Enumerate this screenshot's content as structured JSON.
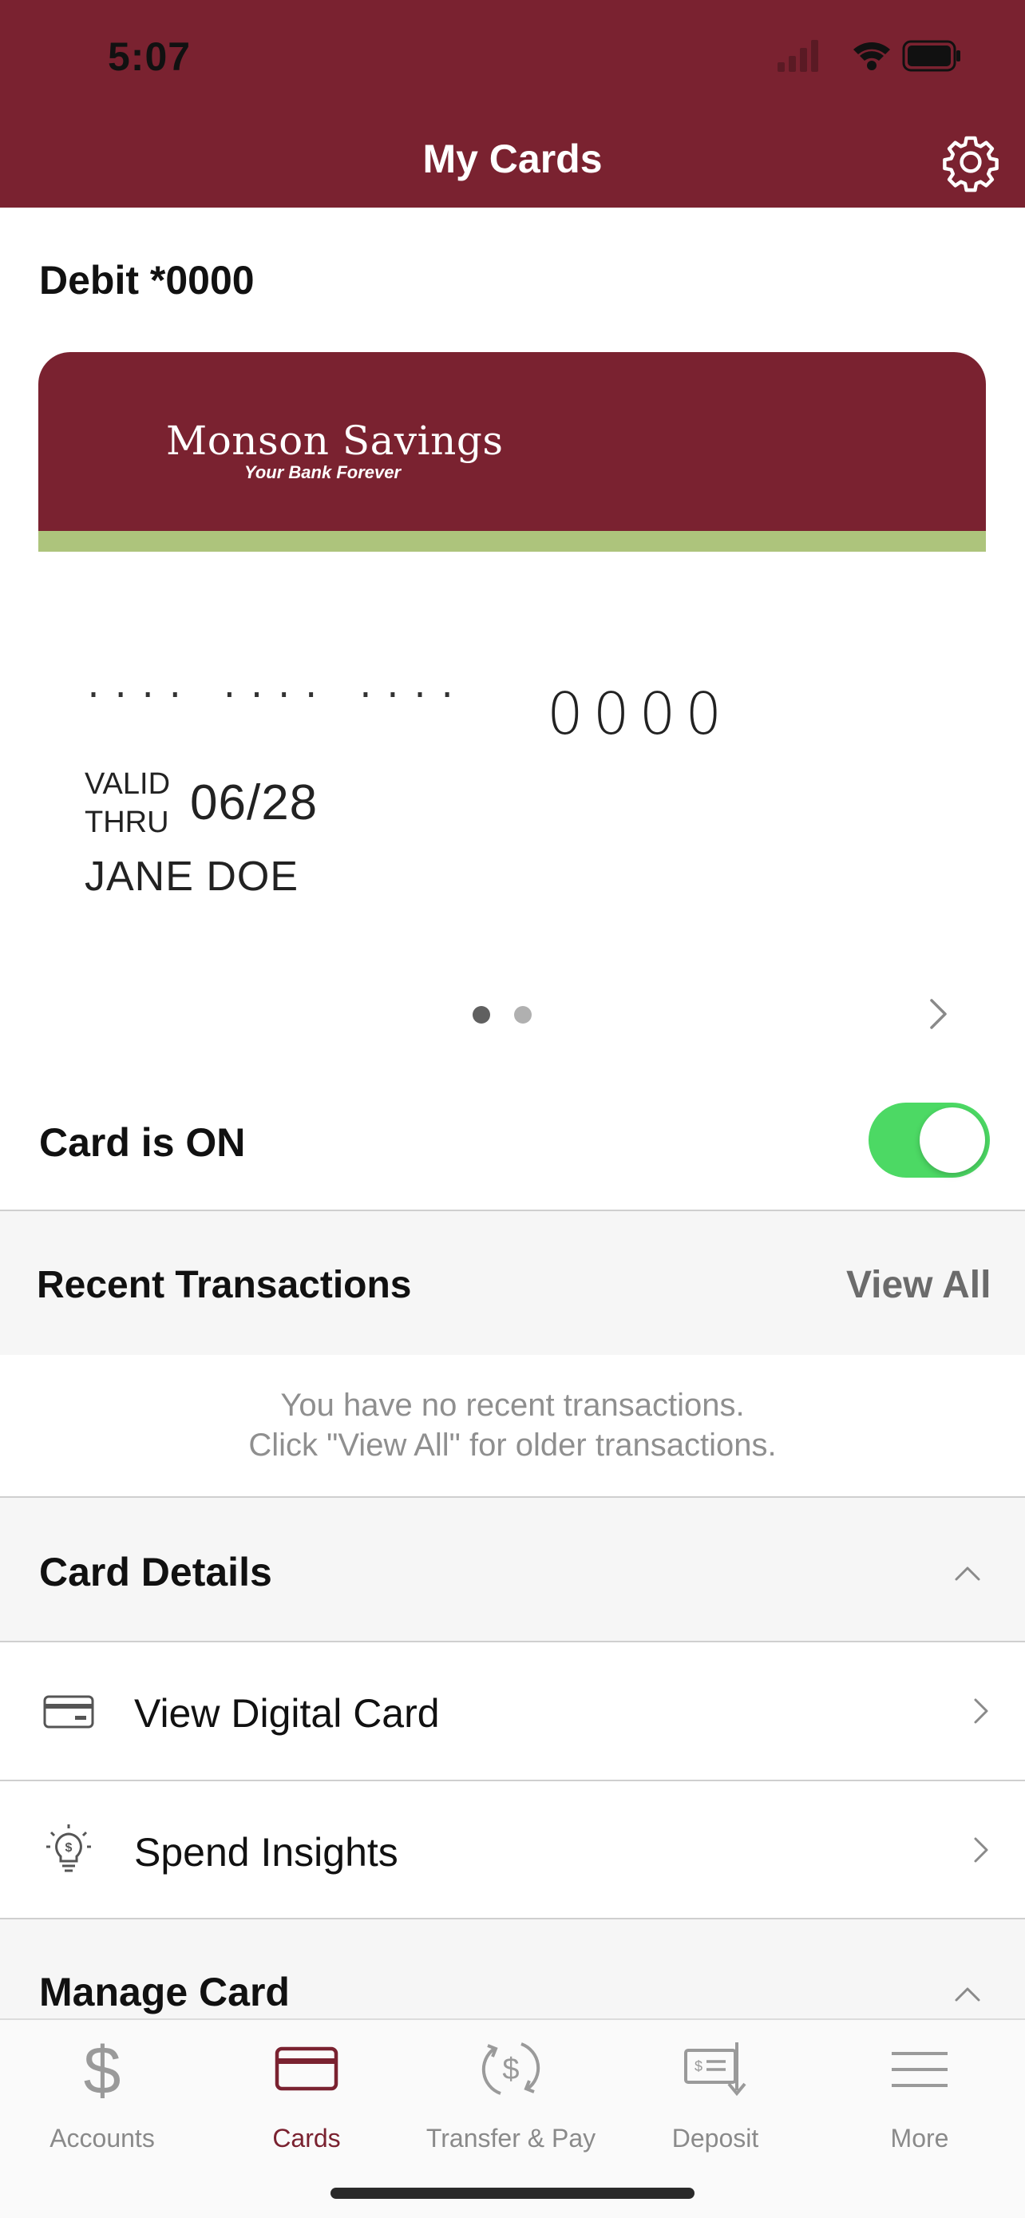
{
  "status_bar": {
    "time": "5:07"
  },
  "header": {
    "title": "My Cards",
    "background_color": "#7a2230"
  },
  "card": {
    "label": "Debit *0000",
    "brand_name": "Monson Savings",
    "brand_tagline": "Your Bank Forever",
    "number_mask": "····  ····  ····",
    "number_last4": "0000",
    "valid_thru_label": "VALID\nTHRU",
    "expiry": "06/28",
    "holder": "JANE DOE",
    "carousel_total": 2,
    "carousel_active": 1
  },
  "card_status": {
    "label": "Card is ON",
    "enabled": true,
    "toggle_color": "#4cd964"
  },
  "recent": {
    "title": "Recent Transactions",
    "view_all": "View All",
    "empty_line1": "You have no recent transactions.",
    "empty_line2": "Click \"View All\" for older transactions."
  },
  "card_details": {
    "title": "Card Details",
    "items": [
      {
        "label": "View Digital Card",
        "icon": "credit-card-icon"
      },
      {
        "label": "Spend Insights",
        "icon": "lightbulb-dollar-icon"
      }
    ]
  },
  "manage_card": {
    "title": "Manage Card"
  },
  "tabs": [
    {
      "label": "Accounts",
      "icon": "dollar-icon",
      "active": false
    },
    {
      "label": "Cards",
      "icon": "card-icon",
      "active": true
    },
    {
      "label": "Transfer & Pay",
      "icon": "transfer-icon",
      "active": false
    },
    {
      "label": "Deposit",
      "icon": "check-deposit-icon",
      "active": false
    },
    {
      "label": "More",
      "icon": "menu-icon",
      "active": false
    }
  ]
}
